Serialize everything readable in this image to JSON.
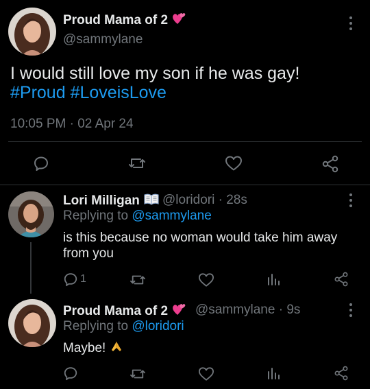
{
  "colors": {
    "accent": "#1d9bf0",
    "secondary": "#71767b",
    "divider": "#2f3336",
    "heart_emoji": "#ec3d8e"
  },
  "main_tweet": {
    "display_name": "Proud Mama of 2",
    "name_emoji": "two-hearts-emoji",
    "handle": "@sammylane",
    "text_line1": "I would still love my son if he was gay!",
    "hashtag1": "#Proud",
    "hashtag2": "#LoveisLove",
    "timestamp": "10:05 PM · 02 Apr 24",
    "actions": [
      "reply-icon",
      "retweet-icon",
      "like-icon",
      "share-icon"
    ]
  },
  "reply1": {
    "display_name": "Lori Milligan",
    "name_emoji": "open-book-emoji",
    "handle_time": "@loridori · 28s",
    "replying_to_label": "Replying to",
    "replying_to_handle": "@sammylane",
    "text_line1": "is this because no woman would take him away",
    "text_line2": "from you",
    "reply_count": "1"
  },
  "reply2": {
    "display_name": "Proud Mama of 2",
    "name_emoji": "two-hearts-emoji",
    "handle_time": "@sammylane · 9s",
    "replying_to_label": "Replying to",
    "replying_to_handle": "@loridori",
    "text": "Maybe!",
    "text_emoji": "folded-hands-emoji"
  }
}
